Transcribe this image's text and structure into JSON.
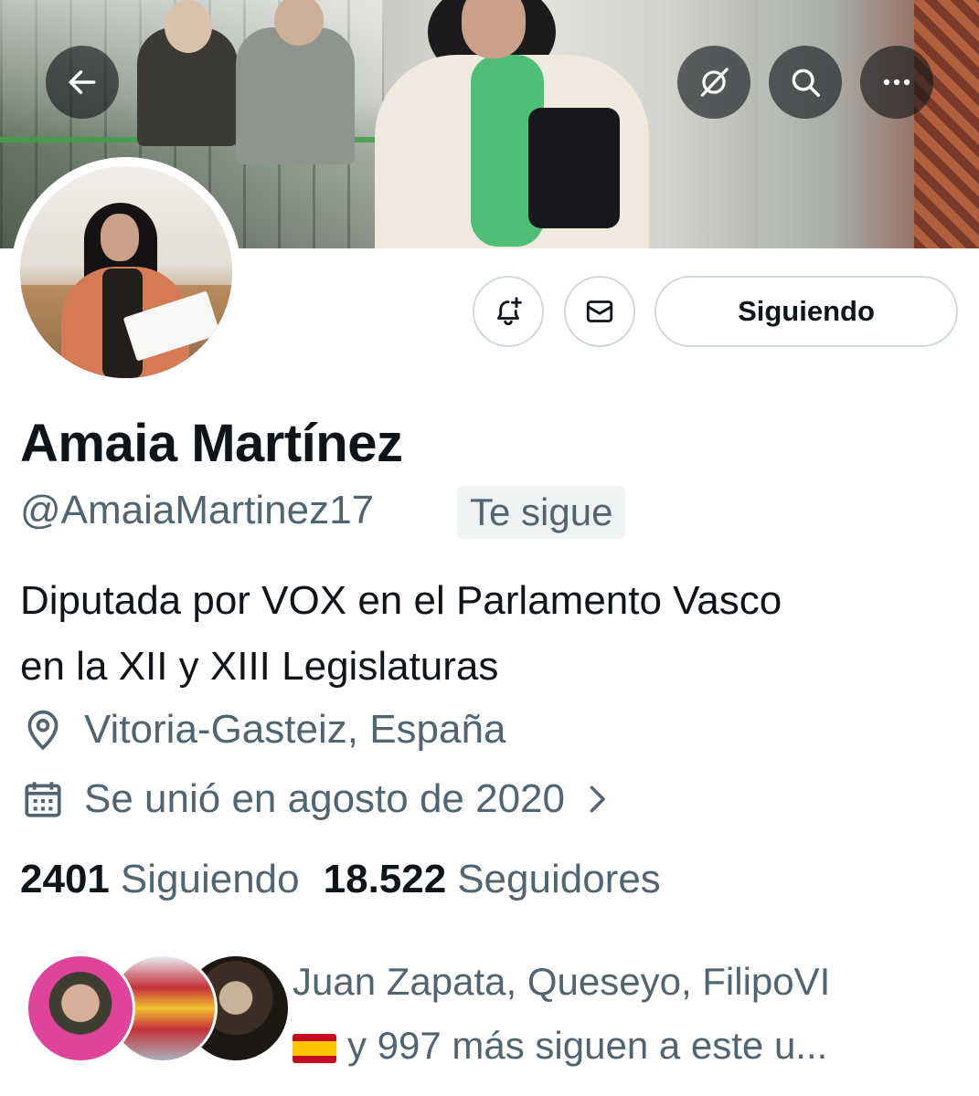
{
  "profile": {
    "name": "Amaia Martínez",
    "handle": "@AmaiaMartinez17",
    "follows_you_label": "Te sigue",
    "bio_line1": "Diputada por VOX en el Parlamento Vasco",
    "bio_line2": "en la XII y XIII Legislaturas",
    "location": "Vitoria-Gasteiz, España",
    "joined": "Se unió en agosto de 2020"
  },
  "actions": {
    "following_button": "Siguiendo"
  },
  "stats": {
    "following_count": "2401",
    "following_label": "Siguiendo",
    "followers_count": "18.522",
    "followers_label": "Seguidores"
  },
  "followers_you_know": {
    "line1": "Juan Zapata, Queseyo, FilipoVI",
    "line2": "y 997 más siguen a este u..."
  },
  "icons": {
    "back": "arrow-left-icon",
    "grok": "grok-icon",
    "search": "search-icon",
    "more": "more-horizontal-icon",
    "notify": "bell-plus-icon",
    "message": "envelope-icon",
    "location": "location-pin-icon",
    "joined": "calendar-icon",
    "chevron": "chevron-right-icon",
    "flag": "spain-flag-emoji"
  },
  "colors": {
    "primary_text": "#0f1419",
    "secondary_text": "#536471",
    "border": "#cfd9de",
    "badge_bg": "#eff3f4"
  }
}
